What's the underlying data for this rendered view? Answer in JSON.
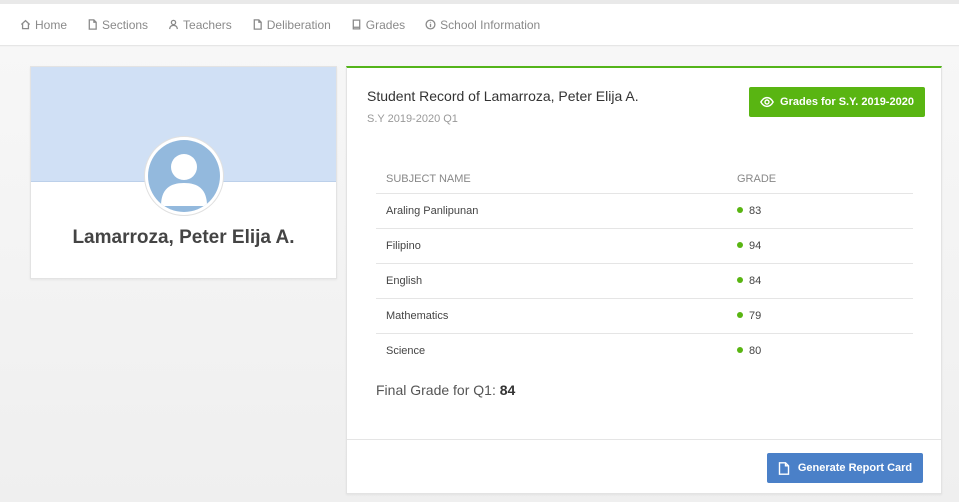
{
  "nav": {
    "items": [
      {
        "label": "Home",
        "icon": "home-icon"
      },
      {
        "label": "Sections",
        "icon": "file-icon"
      },
      {
        "label": "Teachers",
        "icon": "user-icon"
      },
      {
        "label": "Deliberation",
        "icon": "file-icon"
      },
      {
        "label": "Grades",
        "icon": "book-icon"
      },
      {
        "label": "School Information",
        "icon": "info-icon"
      }
    ]
  },
  "profile": {
    "name": "Lamarroza, Peter Elija A."
  },
  "record": {
    "title": "Student Record of Lamarroza, Peter Elija A.",
    "subtitle": "S.Y 2019-2020 Q1",
    "view_button": "Grades for S.Y. 2019-2020",
    "table": {
      "headers": [
        "SUBJECT NAME",
        "GRADE"
      ],
      "rows": [
        {
          "subject": "Araling Panlipunan",
          "grade": "83"
        },
        {
          "subject": "Filipino",
          "grade": "94"
        },
        {
          "subject": "English",
          "grade": "84"
        },
        {
          "subject": "Mathematics",
          "grade": "79"
        },
        {
          "subject": "Science",
          "grade": "80"
        }
      ]
    },
    "final_label": "Final Grade for Q1:",
    "final_value": "84",
    "report_button": "Generate Report Card"
  },
  "colors": {
    "accent_green": "#59b512",
    "accent_blue": "#4a80c8",
    "banner": "#d0e0f5"
  }
}
